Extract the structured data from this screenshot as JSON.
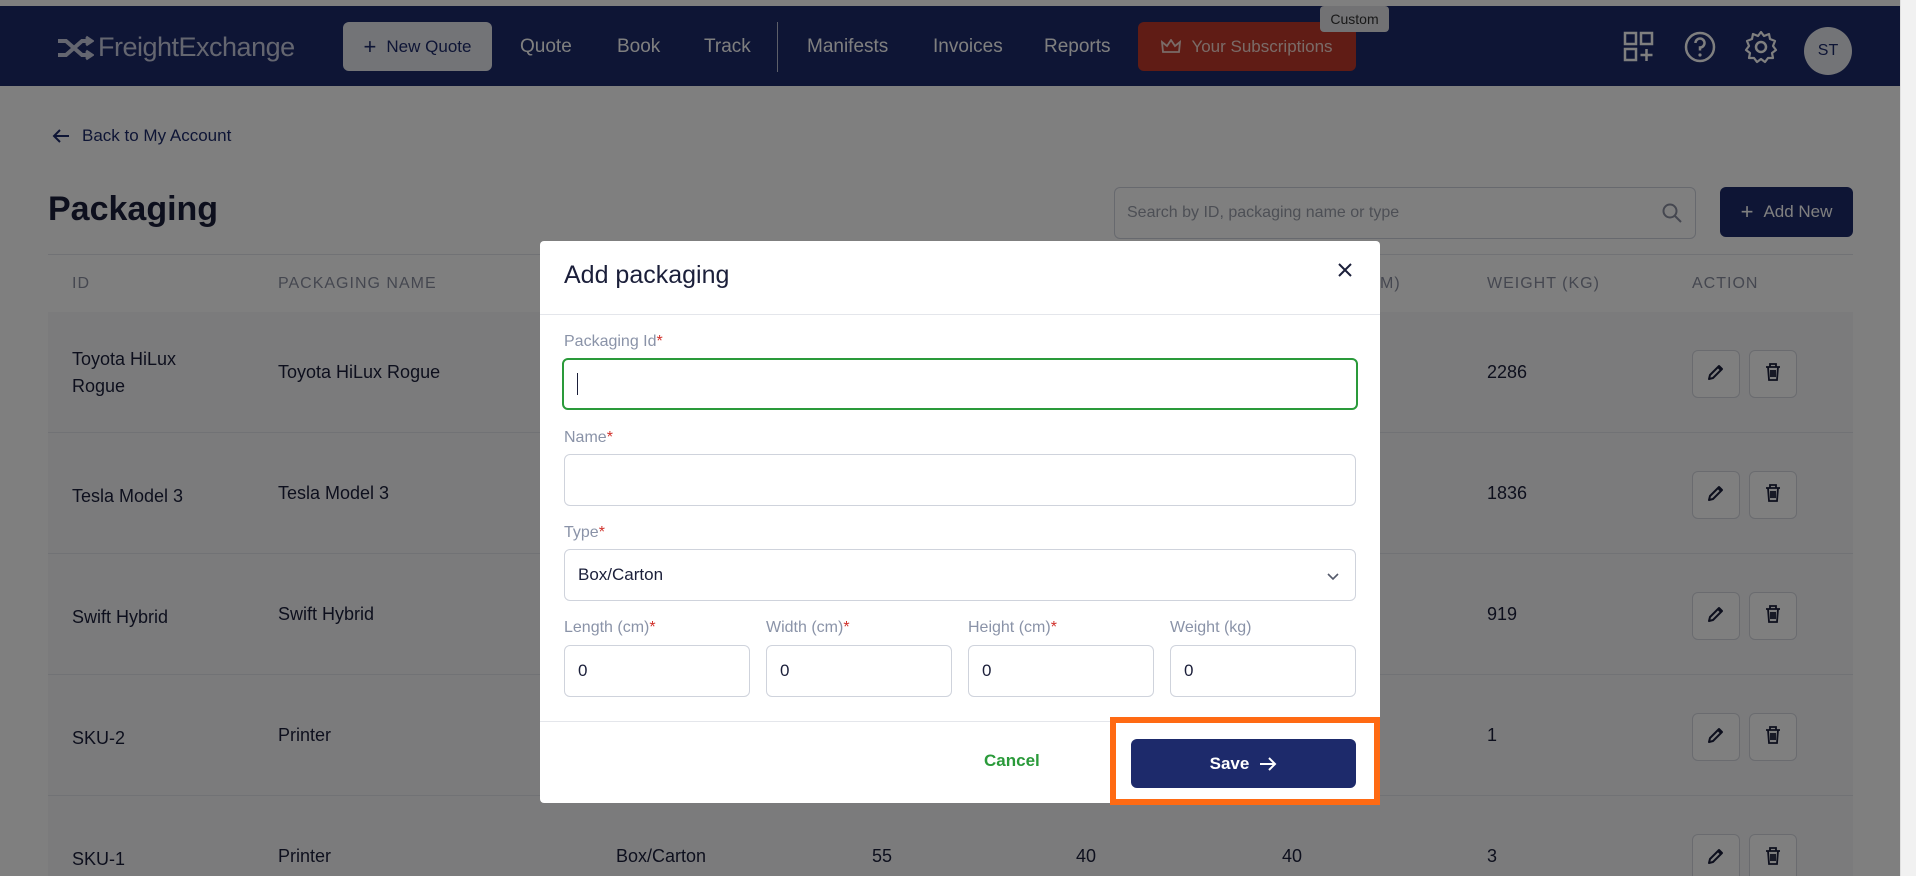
{
  "header": {
    "logo_text": "FreightExchange",
    "new_quote_label": "New Quote",
    "nav": [
      "Quote",
      "Book",
      "Track",
      "Manifests",
      "Invoices",
      "Reports"
    ],
    "subscriptions_label": "Your Subscriptions",
    "custom_badge": "Custom",
    "avatar_initials": "ST",
    "icons": [
      "apps-add-icon",
      "help-icon",
      "gear-icon"
    ]
  },
  "page": {
    "back_label": "Back to My Account",
    "title": "Packaging",
    "search_placeholder": "Search by ID, packaging name or type",
    "add_new_label": "Add New"
  },
  "table": {
    "columns": [
      "ID",
      "PACKAGING NAME",
      "M)",
      "WEIGHT (KG)",
      "ACTION"
    ],
    "rows": [
      {
        "id": "Toyota HiLux Rogue",
        "name": "Toyota HiLux Rogue",
        "type": "",
        "length": "",
        "width": "",
        "height": "",
        "weight": "2286"
      },
      {
        "id": "Tesla Model 3",
        "name": "Tesla Model 3",
        "type": "",
        "length": "",
        "width": "",
        "height": "",
        "weight": "1836"
      },
      {
        "id": "Swift Hybrid",
        "name": "Swift Hybrid",
        "type": "",
        "length": "",
        "width": "",
        "height": "",
        "weight": "919"
      },
      {
        "id": "SKU-2",
        "name": "Printer",
        "type": "",
        "length": "",
        "width": "",
        "height": "",
        "weight": "1"
      },
      {
        "id": "SKU-1",
        "name": "Printer",
        "type": "Box/Carton",
        "length": "55",
        "width": "40",
        "height": "40",
        "weight": "3"
      }
    ]
  },
  "modal": {
    "title": "Add packaging",
    "packaging_id_label": "Packaging Id",
    "packaging_id_value": "",
    "name_label": "Name",
    "name_value": "",
    "type_label": "Type",
    "type_value": "Box/Carton",
    "length_label": "Length (cm)",
    "length_value": "0",
    "width_label": "Width (cm)",
    "width_value": "0",
    "height_label": "Height (cm)",
    "height_value": "0",
    "weight_label": "Weight (kg)",
    "weight_value": "0",
    "required_mark": "*",
    "cancel_label": "Cancel",
    "save_label": "Save"
  },
  "colors": {
    "navbar": "#1d2a6b",
    "subscriptions": "#c0392b",
    "focus_border": "#2a9a3a",
    "highlight": "#ff6a13"
  }
}
